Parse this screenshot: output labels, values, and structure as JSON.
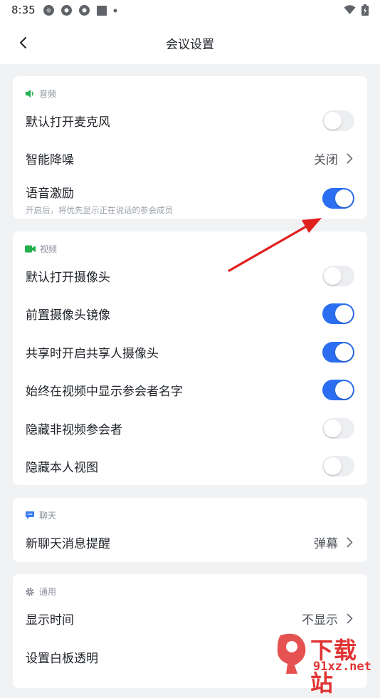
{
  "status_bar": {
    "time": "8:35"
  },
  "header": {
    "title": "会议设置"
  },
  "sections": {
    "audio": {
      "title": "音频",
      "items": [
        {
          "label": "默认打开麦克风",
          "toggle": false
        },
        {
          "label": "智能降噪",
          "value": "关闭"
        },
        {
          "label": "语音激励",
          "sub": "开启后，将优先显示正在说话的参会成员",
          "toggle": true
        }
      ]
    },
    "video": {
      "title": "视频",
      "items": [
        {
          "label": "默认打开摄像头",
          "toggle": false
        },
        {
          "label": "前置摄像头镜像",
          "toggle": true
        },
        {
          "label": "共享时开启共享人摄像头",
          "toggle": true
        },
        {
          "label": "始终在视频中显示参会者名字",
          "toggle": true
        },
        {
          "label": "隐藏非视频参会者",
          "toggle": false
        },
        {
          "label": "隐藏本人视图",
          "toggle": false
        }
      ]
    },
    "chat": {
      "title": "聊天",
      "items": [
        {
          "label": "新聊天消息提醒",
          "value": "弹幕"
        }
      ]
    },
    "general": {
      "title": "通用",
      "items": [
        {
          "label": "显示时间",
          "value": "不显示"
        },
        {
          "label": "设置白板透明"
        }
      ]
    }
  },
  "watermark": {
    "text": "下载站",
    "url": "91xz.net"
  },
  "colors": {
    "accent": "#2b6ef2",
    "audio_icon": "#22b14c",
    "video_icon": "#22b14c",
    "chat_icon": "#3b7cf4",
    "arrow": "#e0201f"
  }
}
